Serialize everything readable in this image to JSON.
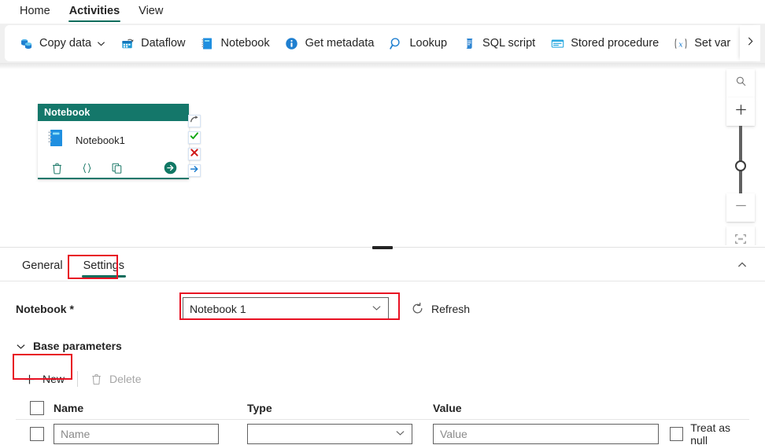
{
  "app": {
    "accent_teal": "#14776a",
    "tab_underline": "#0f6c5c",
    "annotation_red": "#e81123"
  },
  "ribbon": {
    "tabs": [
      {
        "label": "Home",
        "active": false
      },
      {
        "label": "Activities",
        "active": true
      },
      {
        "label": "View",
        "active": false
      }
    ],
    "commands": [
      {
        "label": "Copy data",
        "icon": "copy-data-icon",
        "has_dropdown": true
      },
      {
        "label": "Dataflow",
        "icon": "dataflow-icon",
        "has_dropdown": false
      },
      {
        "label": "Notebook",
        "icon": "notebook-icon",
        "has_dropdown": false
      },
      {
        "label": "Get metadata",
        "icon": "info-icon",
        "has_dropdown": false
      },
      {
        "label": "Lookup",
        "icon": "magnifier-icon",
        "has_dropdown": false
      },
      {
        "label": "SQL script",
        "icon": "sql-script-icon",
        "has_dropdown": false
      },
      {
        "label": "Stored procedure",
        "icon": "stored-procedure-icon",
        "has_dropdown": false
      },
      {
        "label": "Set var",
        "icon": "set-variable-icon",
        "has_dropdown": false
      }
    ],
    "overflow_label": "More commands",
    "overflow_icon": "chevron-right-icon"
  },
  "canvas": {
    "node": {
      "header": "Notebook",
      "title": "Notebook1",
      "icon": "notebook-icon",
      "actions": [
        {
          "name": "delete-activity-icon",
          "label": "Delete"
        },
        {
          "name": "code-view-icon",
          "label": "{ }"
        },
        {
          "name": "duplicate-activity-icon",
          "label": "Duplicate"
        }
      ],
      "run_icon": "run-arrow-icon",
      "connectors": [
        {
          "name": "on-completion-connector",
          "icon": "curved-arrow-icon"
        },
        {
          "name": "on-success-connector",
          "icon": "check-icon"
        },
        {
          "name": "on-failure-connector",
          "icon": "cross-icon"
        },
        {
          "name": "on-skip-connector",
          "icon": "right-arrow-icon"
        }
      ]
    },
    "zoom_controls": [
      {
        "name": "search-canvas-button",
        "icon": "magnifier-icon"
      },
      {
        "name": "zoom-in-button",
        "icon": "plus-icon"
      },
      {
        "name": "zoom-out-button",
        "icon": "minus-icon"
      },
      {
        "name": "fit-to-screen-button",
        "icon": "fit-screen-icon"
      }
    ]
  },
  "panel": {
    "tabs": [
      {
        "label": "General",
        "active": false,
        "annotated": false
      },
      {
        "label": "Settings",
        "active": true,
        "annotated": true
      }
    ],
    "collapse_icon": "chevron-up-icon",
    "notebook_field": {
      "label": "Notebook",
      "required_marker": "*",
      "value": "Notebook 1",
      "dropdown_icon": "chevron-down-icon",
      "annotated": true
    },
    "refresh": {
      "label": "Refresh",
      "icon": "refresh-icon"
    },
    "base_parameters": {
      "label": "Base parameters",
      "expanded": true,
      "chevron_icon": "chevron-down-icon",
      "commands": [
        {
          "label": "New",
          "icon": "plus-icon",
          "disabled": false,
          "annotated": true
        },
        {
          "label": "Delete",
          "icon": "trash-icon",
          "disabled": true,
          "annotated": false
        }
      ],
      "table": {
        "columns": [
          "Name",
          "Type",
          "Value"
        ],
        "select_all_checked": false,
        "rows": [
          {
            "checked": false,
            "name_value": "",
            "name_placeholder": "Name",
            "type_value": "",
            "type_placeholder": "",
            "value_value": "",
            "value_placeholder": "Value",
            "treat_as_null_label": "Treat as null",
            "treat_as_null_checked": false
          }
        ]
      }
    }
  }
}
